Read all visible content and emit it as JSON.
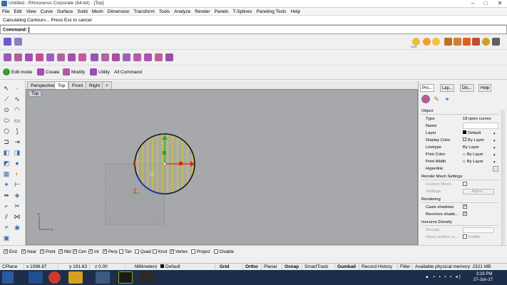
{
  "window": {
    "title": "Untitled - Rhinoceros Corporate (64-bit) - [Top]"
  },
  "menu": [
    "File",
    "Edit",
    "View",
    "Curve",
    "Surface",
    "Solid",
    "Mesh",
    "Dimension",
    "Transform",
    "Tools",
    "Analyze",
    "Render",
    "Panels",
    "T-Splines",
    "Paneling Tools",
    "Help"
  ],
  "command": {
    "history": "Calculating Contours... Press Esc to cancel",
    "prompt": "Command:"
  },
  "toolbar3": {
    "edit_mode": "Edit mode",
    "create": "Create",
    "modify": "Modify",
    "utility": "Utility",
    "all_command": "All Command"
  },
  "toolbar1": {
    "sun_label": "SUN"
  },
  "viewport_tabs": [
    "Perspective",
    "Top",
    "Front",
    "Right"
  ],
  "viewport": {
    "label": "Top"
  },
  "right_panel": {
    "tabs": [
      "Pro...",
      "Lay...",
      "Dis...",
      "Help"
    ],
    "section_object": "Object",
    "props": [
      {
        "k": "Type",
        "v": "18 open curves"
      },
      {
        "k": "Name",
        "v": ""
      },
      {
        "k": "Layer",
        "v": "Default"
      },
      {
        "k": "Display Color",
        "v": "By Layer"
      },
      {
        "k": "Linetype",
        "v": "By Layer"
      },
      {
        "k": "Print Color",
        "v": "By Layer"
      },
      {
        "k": "Print Width",
        "v": "By Layer"
      },
      {
        "k": "Hyperlink",
        "v": ""
      }
    ],
    "section_mesh": "Render Mesh Settings",
    "custom_mesh": "Custom Mesh",
    "settings": "Settings",
    "adjust": "Adjust...",
    "section_render": "Rendering",
    "casts": "Casts shadows",
    "receives": "Receives shado...",
    "section_iso": "Isocurve Density",
    "density": "Density",
    "show_surface": "Show surface is...",
    "visible": "Visible"
  },
  "osnap": [
    {
      "label": "End",
      "checked": true
    },
    {
      "label": "Near",
      "checked": true
    },
    {
      "label": "Point",
      "checked": true
    },
    {
      "label": "Mid",
      "checked": true
    },
    {
      "label": "Cen",
      "checked": true
    },
    {
      "label": "Int",
      "checked": true
    },
    {
      "label": "Perp",
      "checked": true
    },
    {
      "label": "Tan",
      "checked": false
    },
    {
      "label": "Quad",
      "checked": false
    },
    {
      "label": "Knot",
      "checked": false
    },
    {
      "label": "Vertex",
      "checked": true
    },
    {
      "label": "Project",
      "checked": false
    },
    {
      "label": "Disable",
      "checked": false
    }
  ],
  "status": {
    "cplane": "CPlane",
    "x": "x 1096.87",
    "y": "y 191.63",
    "z": "z 0.00",
    "units": "Millimeters",
    "layer": "Default",
    "grid_snap": "Grid Snap",
    "ortho": "Ortho",
    "planar": "Planar",
    "osnap": "Osnap",
    "smarttrack": "SmartTrack",
    "gumball": "Gumball",
    "record_history": "Record History",
    "filter": "Filter",
    "memory": "Available physical memory: 2321 MB"
  },
  "taskbar": {
    "time": "3:33 PM",
    "date": "27-Jun-17"
  }
}
